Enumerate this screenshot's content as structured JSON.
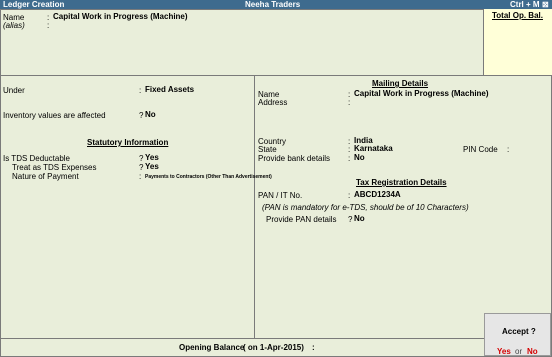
{
  "titlebar": {
    "left": "Ledger Creation",
    "center": "Neeha Traders",
    "right": "Ctrl + M",
    "close": "⊠"
  },
  "header": {
    "name_label": "Name",
    "name_value": "Capital Work in Progress (Machine)",
    "alias_label": "(alias)",
    "sep": ":"
  },
  "op_bal": {
    "title": "Total Op. Bal."
  },
  "left": {
    "under_label": "Under",
    "under_value": "Fixed Assets",
    "inv_label": "Inventory values are affected",
    "inv_q": "?",
    "inv_value": "No",
    "statutory_heading": "Statutory Information",
    "tds_label": "Is TDS Deductable",
    "tds_value": "Yes",
    "treat_label": "Treat as TDS Expenses",
    "treat_value": "Yes",
    "nature_label": "Nature of Payment",
    "nature_value": "Payments to Contractors (Other Than Advertisement)"
  },
  "right": {
    "mailing_heading": "Mailing Details",
    "name_label": "Name",
    "name_value": "Capital Work in Progress (Machine)",
    "address_label": "Address",
    "country_label": "Country",
    "country_value": "India",
    "state_label": "State",
    "state_value": "Karnataka",
    "pin_label": "PIN Code",
    "bank_label": "Provide bank details",
    "bank_value": "No",
    "tax_heading": "Tax Registration Details",
    "pan_label": "PAN / IT No.",
    "pan_value": "ABCD1234A",
    "pan_note": "(PAN is mandatory for e-TDS, should be of 10 Characters)",
    "provide_pan_label": "Provide PAN details",
    "provide_pan_value": "No"
  },
  "footer": {
    "label": "Opening Balance",
    "date": "( on 1-Apr-2015)",
    "colon": ":"
  },
  "accept": {
    "title": "Accept ?",
    "yes": "Yes",
    "or": "or",
    "no": "No"
  }
}
